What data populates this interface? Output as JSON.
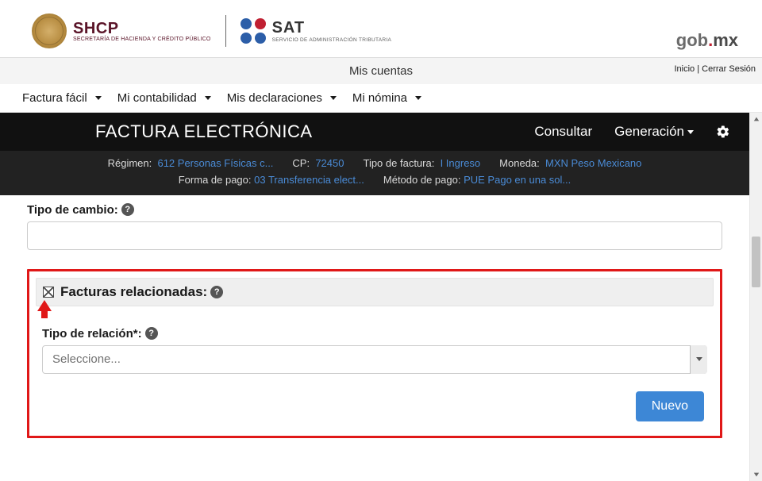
{
  "header": {
    "shcp_title": "SHCP",
    "shcp_sub": "SECRETARÍA DE HACIENDA Y CRÉDITO PÚBLICO",
    "sat_title": "SAT",
    "sat_sub": "SERVICIO DE ADMINISTRACIÓN TRIBUTARIA",
    "gob": "gob",
    "mx": "mx"
  },
  "subheader": {
    "title": "Mis cuentas",
    "link_home": "Inicio",
    "link_logout": "Cerrar Sesión",
    "separator": " | "
  },
  "menu": {
    "items": [
      {
        "label": "Factura fácil"
      },
      {
        "label": "Mi contabilidad"
      },
      {
        "label": "Mis declaraciones"
      },
      {
        "label": "Mi nómina"
      }
    ]
  },
  "blackbar": {
    "title": "FACTURA ELECTRÓNICA",
    "consultar": "Consultar",
    "generacion": "Generación"
  },
  "info": {
    "regimen_lbl": "Régimen:",
    "regimen_val": "612 Personas Físicas c...",
    "cp_lbl": "CP:",
    "cp_val": "72450",
    "tipo_factura_lbl": "Tipo de factura:",
    "tipo_factura_val": "I Ingreso",
    "moneda_lbl": "Moneda:",
    "moneda_val": "MXN Peso Mexicano",
    "forma_pago_lbl": "Forma de pago:",
    "forma_pago_val": "03 Transferencia elect...",
    "metodo_pago_lbl": "Método de pago:",
    "metodo_pago_val": "PUE Pago en una sol..."
  },
  "form": {
    "tipo_cambio_label": "Tipo de cambio:",
    "tipo_cambio_value": "",
    "facturas_rel_label": "Facturas relacionadas:",
    "tipo_relacion_label": "Tipo de relación*:",
    "select_placeholder": "Seleccione...",
    "nuevo_btn": "Nuevo"
  }
}
